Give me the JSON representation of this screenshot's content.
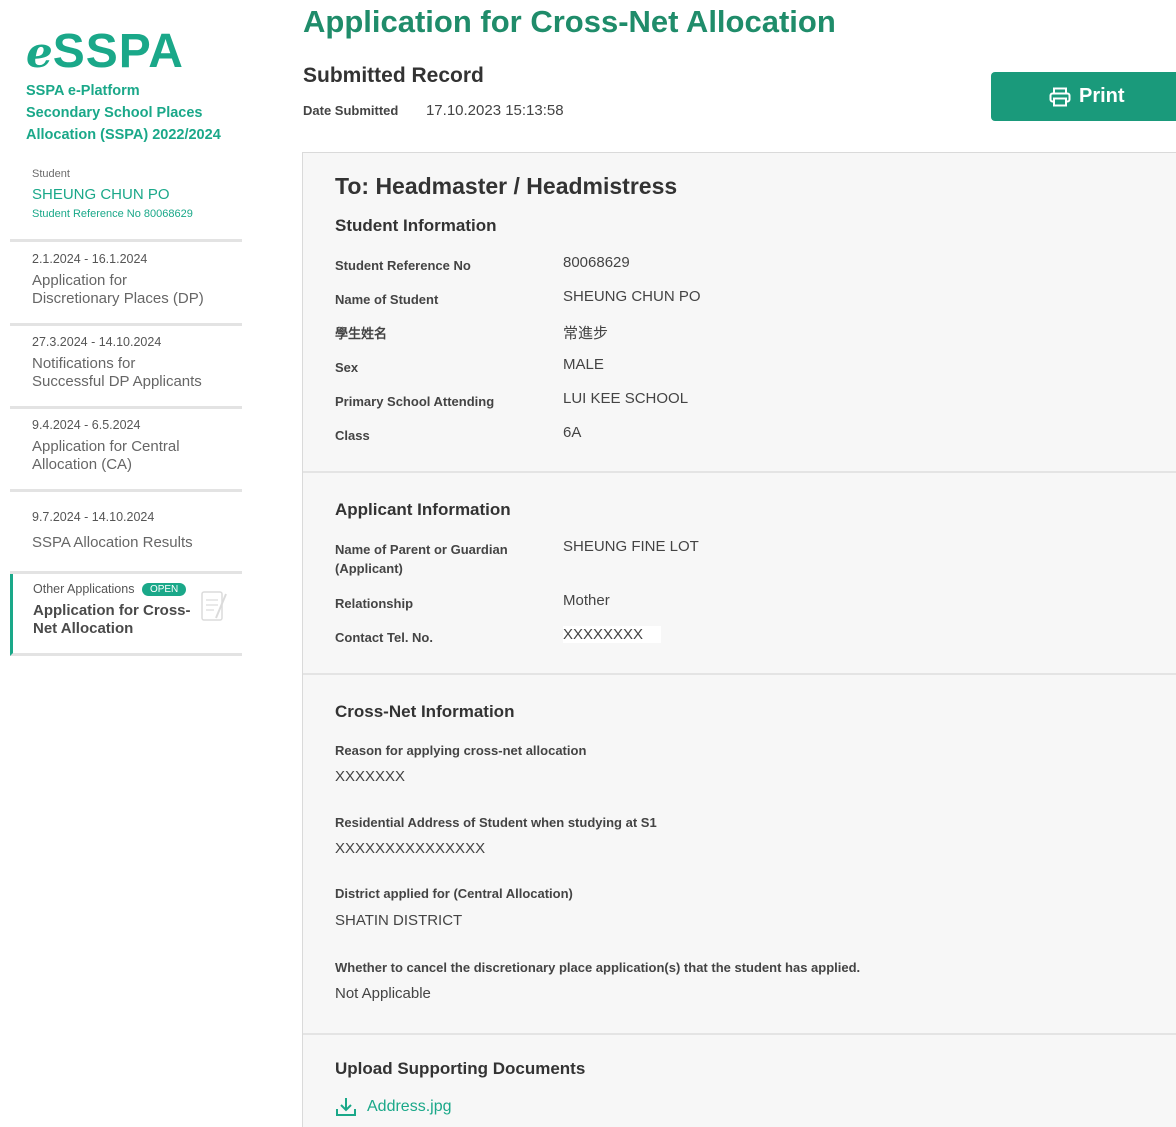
{
  "brand": {
    "logo_e": "e",
    "logo_sspa": "SSPA",
    "line1": "SSPA e-Platform",
    "line2": "Secondary School Places",
    "line3": "Allocation (SSPA) 2022/2024"
  },
  "student": {
    "label": "Student",
    "name": "SHEUNG CHUN PO",
    "ref": "Student Reference No 80068629"
  },
  "nav": [
    {
      "dates": "2.1.2024 - 16.1.2024",
      "line1": "Application for",
      "line2": "Discretionary Places (DP)"
    },
    {
      "dates": "27.3.2024 - 14.10.2024",
      "line1": "Notifications for",
      "line2": "Successful DP Applicants"
    },
    {
      "dates": "9.4.2024 - 6.5.2024",
      "line1": "Application for Central",
      "line2": "Allocation (CA)"
    },
    {
      "dates": "9.7.2024 - 14.10.2024",
      "line1": "SSPA Allocation Results",
      "line2": ""
    },
    {
      "dates": "Other Applications",
      "badge": "OPEN",
      "line1": "Application for Cross-",
      "line2": "Net Allocation"
    }
  ],
  "page": {
    "title": "Application for Cross-Net Allocation",
    "subtitle": "Submitted Record",
    "date_label": "Date Submitted",
    "date_value": "17.10.2023 15:13:58",
    "print_label": "Print"
  },
  "record": {
    "to": "To: Headmaster / Headmistress",
    "student_info": {
      "title": "Student Information",
      "fields": [
        {
          "label": "Student Reference No",
          "value": "80068629"
        },
        {
          "label": "Name of Student",
          "value": "SHEUNG CHUN PO"
        },
        {
          "label": "學生姓名",
          "value": "常進步"
        },
        {
          "label": "Sex",
          "value": "MALE"
        },
        {
          "label": "Primary School Attending",
          "value": "LUI KEE SCHOOL"
        },
        {
          "label": "Class",
          "value": "6A"
        }
      ]
    },
    "applicant_info": {
      "title": "Applicant Information",
      "fields": [
        {
          "label": "Name of Parent or Guardian (Applicant)",
          "value": "SHEUNG FINE LOT"
        },
        {
          "label": "Relationship",
          "value": "Mother"
        },
        {
          "label": "Contact Tel. No.",
          "value": "XXXXXXXX"
        }
      ]
    },
    "crossnet_info": {
      "title": "Cross-Net Information",
      "items": [
        {
          "label": "Reason for applying cross-net allocation",
          "value": "XXXXXXX"
        },
        {
          "label": "Residential Address of Student when studying at S1",
          "value": "XXXXXXXXXXXXXXX"
        },
        {
          "label": "District applied for (Central Allocation)",
          "value": "SHATIN DISTRICT"
        },
        {
          "label": "Whether to cancel the discretionary place application(s) that the student has applied.",
          "value": "Not Applicable"
        }
      ]
    },
    "upload": {
      "title": "Upload Supporting Documents",
      "file": "Address.jpg"
    }
  },
  "colors": {
    "brand": "#1aa889",
    "title": "#1f8c6a",
    "print_bg": "#1a9a7b"
  }
}
